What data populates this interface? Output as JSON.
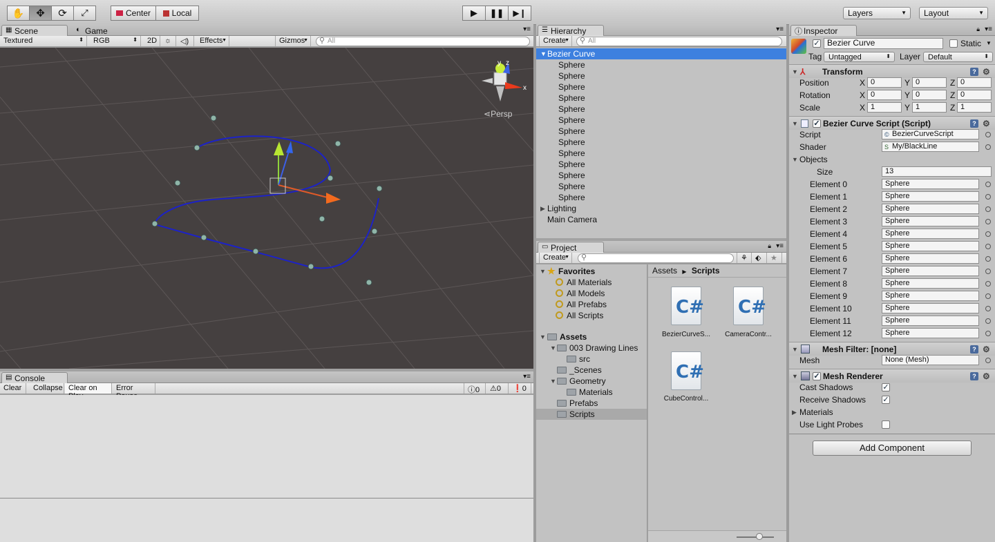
{
  "toolbar": {
    "pivot_label": "Center",
    "space_label": "Local",
    "layers_label": "Layers",
    "layout_label": "Layout"
  },
  "scene": {
    "tab_scene": "Scene",
    "tab_game": "Game",
    "shading_mode": "Textured",
    "render_mode": "RGB",
    "mode_2d": "2D",
    "effects_label": "Effects",
    "gizmos_label": "Gizmos",
    "search_placeholder": "All",
    "persp_label": "Persp",
    "axis_x": "x",
    "axis_y": "y",
    "axis_z": "z"
  },
  "console": {
    "tab": "Console",
    "buttons": [
      "Clear",
      "Collapse",
      "Clear on Play",
      "Error Pause"
    ],
    "counts": {
      "errors": "0",
      "warnings": "0",
      "logs": "0"
    }
  },
  "hierarchy": {
    "tab": "Hierarchy",
    "create_label": "Create",
    "search_placeholder": "All",
    "root": "Bezier Curve",
    "children": [
      "Sphere",
      "Sphere",
      "Sphere",
      "Sphere",
      "Sphere",
      "Sphere",
      "Sphere",
      "Sphere",
      "Sphere",
      "Sphere",
      "Sphere",
      "Sphere",
      "Sphere"
    ],
    "others": [
      "Lighting",
      "Main Camera"
    ]
  },
  "project": {
    "tab": "Project",
    "create_label": "Create",
    "favorites_label": "Favorites",
    "favorites": [
      "All Materials",
      "All Models",
      "All Prefabs",
      "All Scripts"
    ],
    "assets_label": "Assets",
    "tree": [
      "003 Drawing Lines",
      "src",
      "_Scenes",
      "Geometry",
      "Materials",
      "Prefabs",
      "Scripts"
    ],
    "breadcrumb": [
      "Assets",
      "Scripts"
    ],
    "files": [
      "BezierCurveS...",
      "CameraContr...",
      "CubeControl..."
    ]
  },
  "inspector": {
    "tab": "Inspector",
    "object_name": "Bezier Curve",
    "static_label": "Static",
    "tag_label": "Tag",
    "tag_value": "Untagged",
    "layer_label": "Layer",
    "layer_value": "Default",
    "transform": {
      "title": "Transform",
      "position_label": "Position",
      "rotation_label": "Rotation",
      "scale_label": "Scale",
      "position": [
        "0",
        "0",
        "0"
      ],
      "rotation": [
        "0",
        "0",
        "0"
      ],
      "scale": [
        "1",
        "1",
        "1"
      ],
      "axes": [
        "X",
        "Y",
        "Z"
      ]
    },
    "script_comp": {
      "title": "Bezier Curve Script (Script)",
      "script_label": "Script",
      "script_value": "BezierCurveScript",
      "shader_label": "Shader",
      "shader_value": "My/BlackLine",
      "objects_label": "Objects",
      "size_label": "Size",
      "size_value": "13",
      "elements": [
        {
          "label": "Element 0",
          "value": "Sphere"
        },
        {
          "label": "Element 1",
          "value": "Sphere"
        },
        {
          "label": "Element 2",
          "value": "Sphere"
        },
        {
          "label": "Element 3",
          "value": "Sphere"
        },
        {
          "label": "Element 4",
          "value": "Sphere"
        },
        {
          "label": "Element 5",
          "value": "Sphere"
        },
        {
          "label": "Element 6",
          "value": "Sphere"
        },
        {
          "label": "Element 7",
          "value": "Sphere"
        },
        {
          "label": "Element 8",
          "value": "Sphere"
        },
        {
          "label": "Element 9",
          "value": "Sphere"
        },
        {
          "label": "Element 10",
          "value": "Sphere"
        },
        {
          "label": "Element 11",
          "value": "Sphere"
        },
        {
          "label": "Element 12",
          "value": "Sphere"
        }
      ]
    },
    "mesh_filter": {
      "title": "Mesh Filter: [none]",
      "mesh_label": "Mesh",
      "mesh_value": "None (Mesh)"
    },
    "mesh_renderer": {
      "title": "Mesh Renderer",
      "cast_shadows_label": "Cast Shadows",
      "receive_shadows_label": "Receive Shadows",
      "materials_label": "Materials",
      "light_probes_label": "Use Light Probes"
    },
    "add_component_label": "Add Component"
  }
}
